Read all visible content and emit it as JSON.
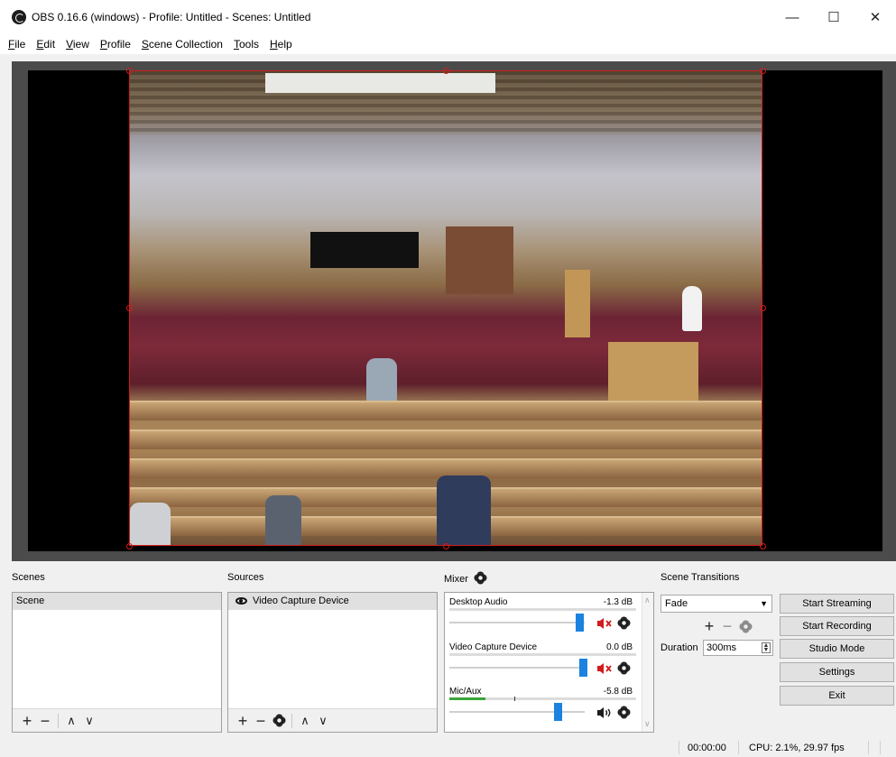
{
  "window": {
    "title": "OBS 0.16.6 (windows) - Profile: Untitled - Scenes: Untitled",
    "minimize": "—",
    "maximize": "☐",
    "close": "✕"
  },
  "menu": [
    "File",
    "Edit",
    "View",
    "Profile",
    "Scene Collection",
    "Tools",
    "Help"
  ],
  "scenes": {
    "title": "Scenes",
    "items": [
      "Scene"
    ]
  },
  "sources": {
    "title": "Sources",
    "items": [
      "Video Capture Device"
    ]
  },
  "mixer": {
    "title": "Mixer",
    "channels": [
      {
        "name": "Desktop Audio",
        "db": "-1.3 dB",
        "muted": true,
        "level": 0.0,
        "volume": 0.95
      },
      {
        "name": "Video Capture Device",
        "db": "0.0 dB",
        "muted": true,
        "level": 0.0,
        "volume": 1.0
      },
      {
        "name": "Mic/Aux",
        "db": "-5.8 dB",
        "muted": false,
        "level": 0.2,
        "volume": 0.8
      }
    ]
  },
  "transitions": {
    "title": "Scene Transitions",
    "selected": "Fade",
    "duration_label": "Duration",
    "duration_value": "300ms"
  },
  "controls": {
    "start_streaming": "Start Streaming",
    "start_recording": "Start Recording",
    "studio_mode": "Studio Mode",
    "settings": "Settings",
    "exit": "Exit"
  },
  "status": {
    "time": "00:00:00",
    "cpu": "CPU: 2.1%, 29.97 fps"
  },
  "colors": {
    "accent": "#1a83e0",
    "mute_red": "#d21c1c",
    "meter_green": "#3aa63a"
  }
}
